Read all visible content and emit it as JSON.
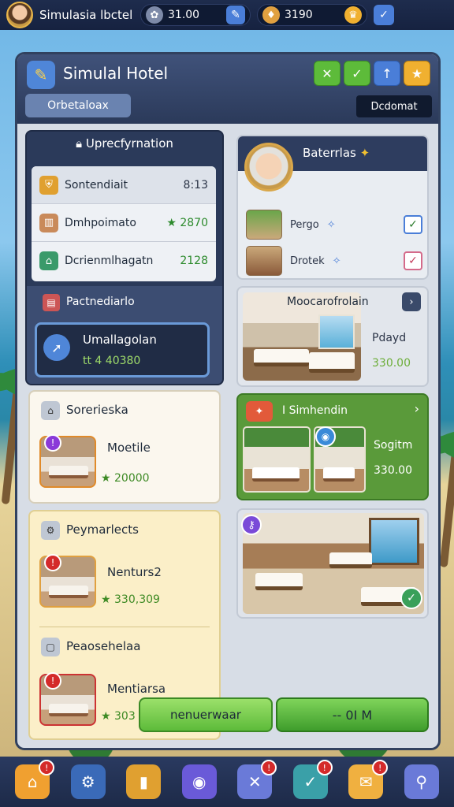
{
  "topbar": {
    "title": "Simulasia lbctel",
    "resource1": "31.00",
    "resource2": "3190"
  },
  "panel": {
    "title": "Simulal Hotel",
    "subtab": "Orbetaloax",
    "right_label": "Dcdomat"
  },
  "info": {
    "title": "Uprecfyrnation",
    "stats": [
      {
        "label": "Sontendiait",
        "value": "8:13"
      },
      {
        "label": "Dmhpoimato",
        "value": "2870"
      },
      {
        "label": "Dcrienmlhagatn",
        "value": "2128"
      }
    ],
    "section_title": "Pactnediarlo",
    "highlight_label": "Umallagolan",
    "highlight_value": "tt 4 40380"
  },
  "services": {
    "title": "Sorerieska",
    "item_name": "Moetile",
    "item_price": "20000"
  },
  "payments": {
    "title": "Peymarlects",
    "item1_name": "Nenturs2",
    "item1_price": "330,309",
    "section2_title": "Peaosehelaa",
    "item2_name": "Mentiarsa",
    "item2_price": "303"
  },
  "staff": {
    "title": "Baterrlas",
    "rows": [
      {
        "label": "Pergo"
      },
      {
        "label": "Drotek"
      }
    ]
  },
  "room": {
    "title": "Moocarofrolain",
    "side_label": "Pdayd",
    "side_price": "330.00"
  },
  "green": {
    "title": "I Simhendin",
    "side_label": "Sogitm",
    "side_price": "330.00"
  },
  "actions": {
    "left": "nenuerwaar",
    "right": "-- 0I M"
  },
  "colors": {
    "accent_green": "#5dbb3a",
    "accent_blue": "#4a7ed8",
    "panel_dark": "#2b3a5a"
  }
}
